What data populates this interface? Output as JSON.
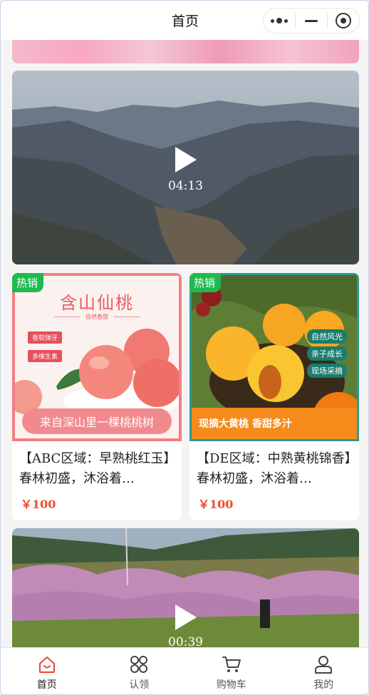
{
  "header": {
    "title": "首页",
    "capsule": {
      "more_icon": "dots-icon",
      "minimize_icon": "minus-icon",
      "close_icon": "target-icon"
    }
  },
  "videos": [
    {
      "duration": "04:13"
    },
    {
      "duration": "00:39"
    }
  ],
  "products": [
    {
      "badge": "热销",
      "image_title": "含山仙桃",
      "image_subtitle": "自然香甜",
      "image_tags": [
        "香软弹牙",
        "多维生素"
      ],
      "image_slogan": "来自深山里一棵桃桃树",
      "title": "【ABC区域：早熟桃红玉】春林初盛，沐浴着…",
      "price": "￥100"
    },
    {
      "badge": "热销",
      "image_tags": [
        "自然风光",
        "亲子成长",
        "现场采摘"
      ],
      "image_slogan": "现摘大黄桃 香甜多汁",
      "title": "【DE区域：中熟黄桃锦香】春林初盛，沐浴着…",
      "price": "￥100"
    }
  ],
  "tabbar": {
    "items": [
      {
        "label": "首页",
        "icon": "home-icon",
        "active": true
      },
      {
        "label": "认领",
        "icon": "grid-icon",
        "active": false
      },
      {
        "label": "购物车",
        "icon": "cart-icon",
        "active": false
      },
      {
        "label": "我的",
        "icon": "user-icon",
        "active": false
      }
    ],
    "active_color": "#e8453c"
  }
}
